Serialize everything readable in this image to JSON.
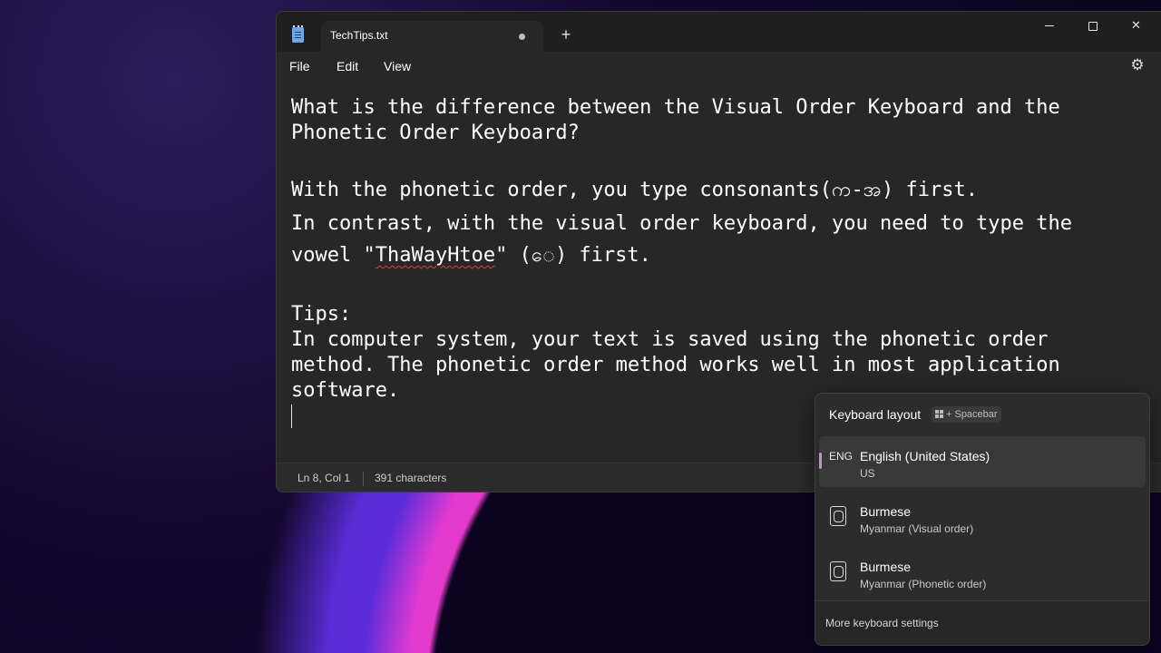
{
  "notepad": {
    "tab_title": "TechTips.txt",
    "new_tab_label": "+",
    "menu": {
      "file": "File",
      "edit": "Edit",
      "view": "View"
    },
    "content": {
      "line1": "What is the difference between the Visual Order Keyboard and the",
      "line2": "Phonetic Order Keyboard?",
      "line3": "With the phonetic order, you type consonants(က-အ) first.",
      "line4": "In contrast, with the visual order keyboard, you need to type the",
      "line5_before": "vowel \"",
      "line5_misspelled": "ThaWayHtoe",
      "line5_after": "\" (ေ) first.",
      "line6": "Tips:",
      "line7": "In computer system, your text is saved using the phonetic order",
      "line8": "method. The phonetic order method works well in most application",
      "line9": "software."
    },
    "status": {
      "position": "Ln 8, Col 1",
      "characters": "391 characters"
    }
  },
  "keyboard_flyout": {
    "header": "Keyboard layout",
    "shortcut": "+ Spacebar",
    "items": [
      {
        "code": "ENG",
        "name": "English (United States)",
        "sub": "US",
        "selected": true
      },
      {
        "icon": "keyboard-icon",
        "name": "Burmese",
        "sub": "Myanmar (Visual order)",
        "selected": false
      },
      {
        "icon": "keyboard-icon",
        "name": "Burmese",
        "sub": "Myanmar (Phonetic order)",
        "selected": false
      }
    ],
    "footer": "More keyboard settings"
  },
  "colors": {
    "accent_selection": "#c68ad8",
    "window_bg": "#272727",
    "spellcheck": "#e0413d"
  }
}
